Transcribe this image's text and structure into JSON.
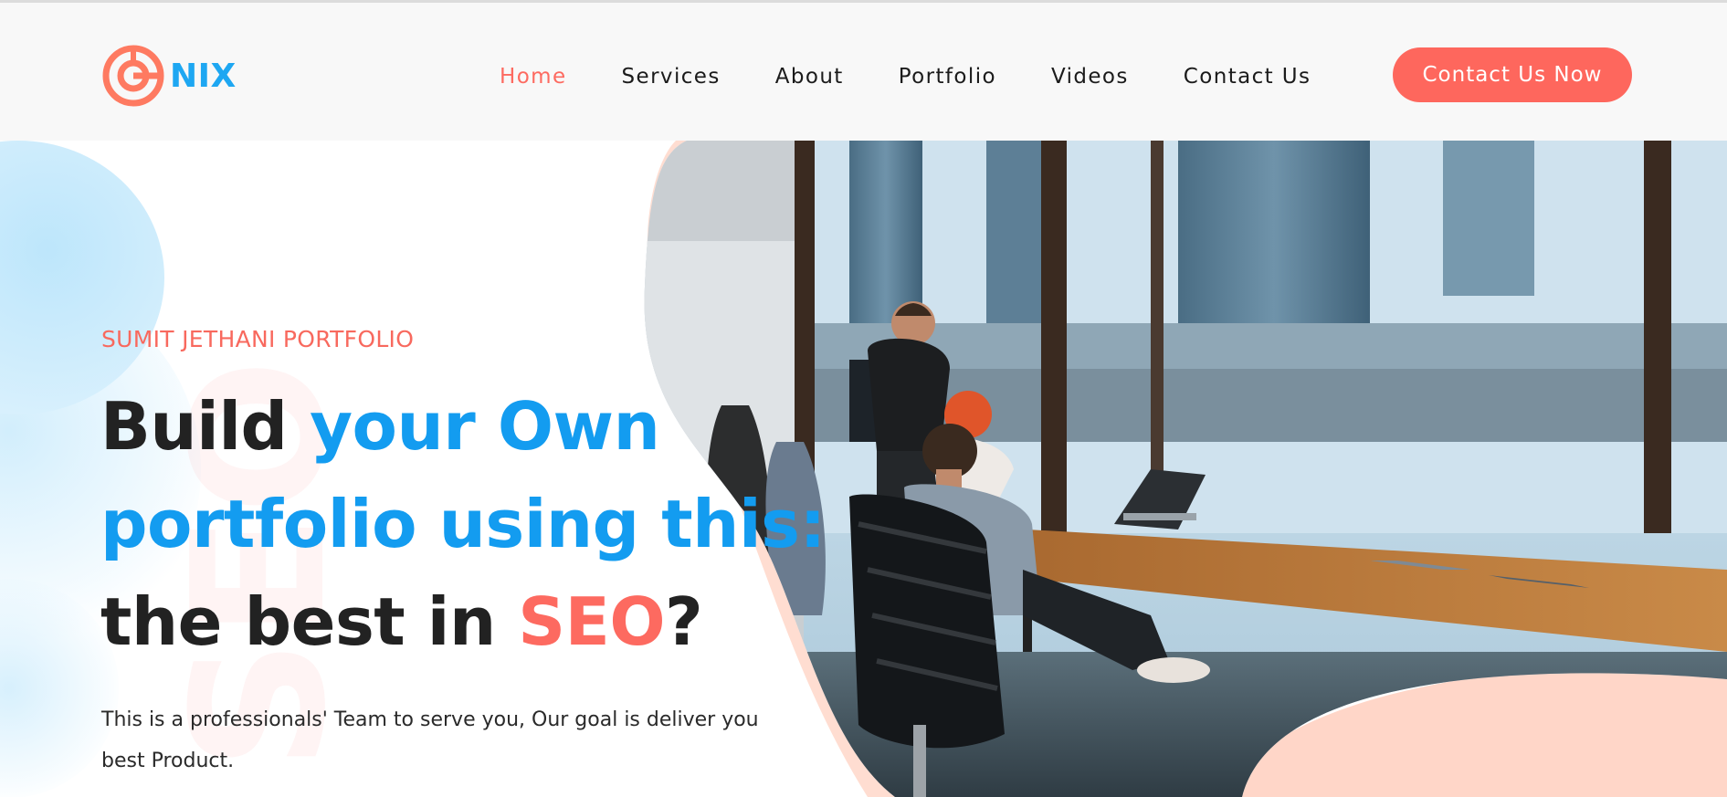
{
  "brand": {
    "name": "NIX",
    "logo_icon": "nix-logo-icon"
  },
  "nav": {
    "items": [
      {
        "label": "Home",
        "active": true
      },
      {
        "label": "Services",
        "active": false
      },
      {
        "label": "About",
        "active": false
      },
      {
        "label": "Portfolio",
        "active": false
      },
      {
        "label": "Videos",
        "active": false
      },
      {
        "label": "Contact Us",
        "active": false
      }
    ],
    "cta_label": "Contact Us Now"
  },
  "hero": {
    "eyebrow": "SUMIT JETHANI PORTFOLIO",
    "headline": {
      "part1": "Build ",
      "part2": "your Own portfolio using this:",
      "part3": " the best in ",
      "part4": "SEO",
      "part5": "?"
    },
    "description": "This is a professionals' Team to serve you, Our goal is deliver you best Product.",
    "image": "office-team-photo"
  },
  "colors": {
    "accent_coral": "#fd6a60",
    "accent_blue": "#139cf0",
    "header_bg": "#f8f8f8",
    "text_dark": "#222222"
  }
}
